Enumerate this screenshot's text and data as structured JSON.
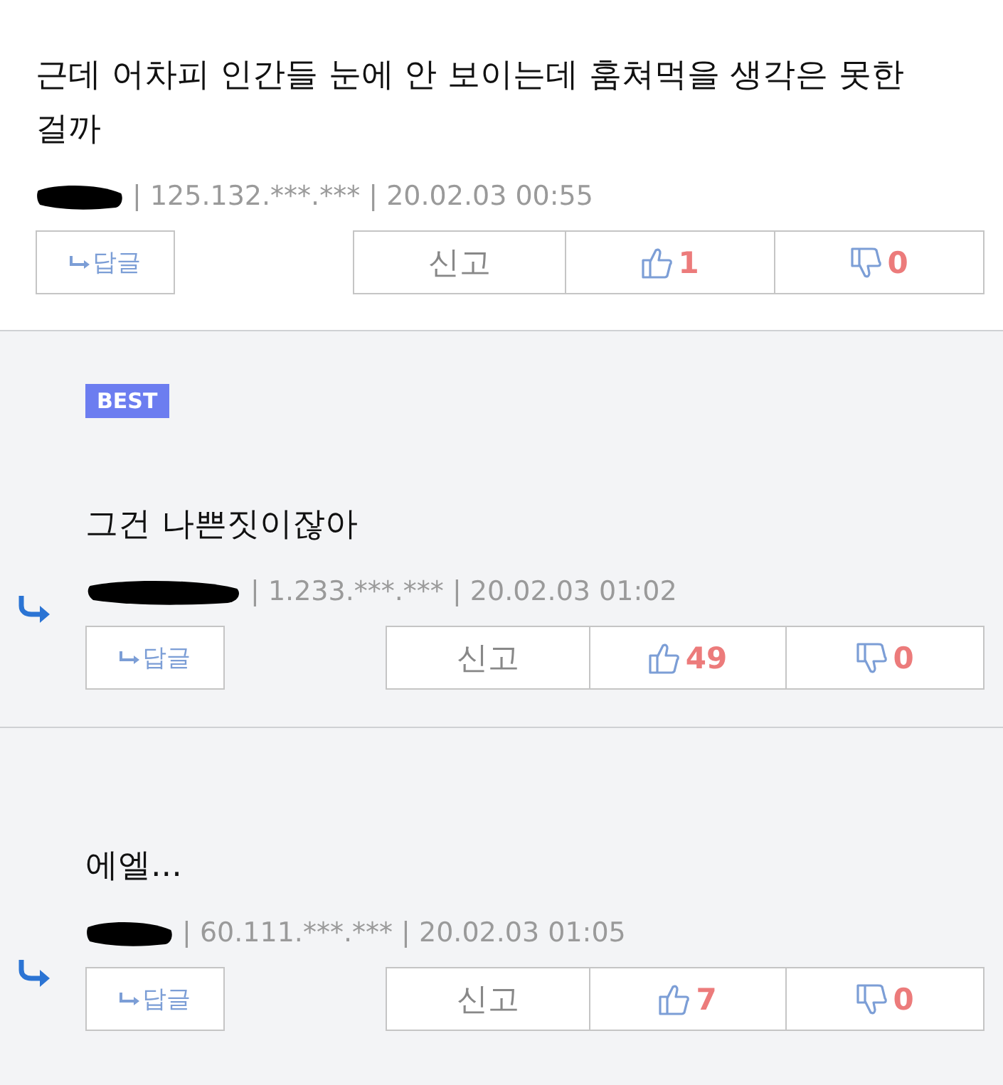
{
  "comments": [
    {
      "kind": "comment",
      "best": false,
      "text": "근데 어차피 인간들 눈에 안 보이는데 훔쳐먹을 생각은 못한 걸까",
      "meta": "| 125.132.***.*** | 20.02.03 00:55",
      "reply_label": "답글",
      "report_label": "신고",
      "likes": "1",
      "dislikes": "0"
    },
    {
      "kind": "reply",
      "best": true,
      "badge": "BEST",
      "text": "그건 나쁜짓이잖아",
      "meta": "| 1.233.***.*** | 20.02.03 01:02",
      "reply_label": "답글",
      "report_label": "신고",
      "likes": "49",
      "dislikes": "0"
    },
    {
      "kind": "reply",
      "best": false,
      "text": "에엘...",
      "meta": "| 60.111.***.*** | 20.02.03 01:05",
      "reply_label": "답글",
      "report_label": "신고",
      "likes": "7",
      "dislikes": "0"
    }
  ]
}
